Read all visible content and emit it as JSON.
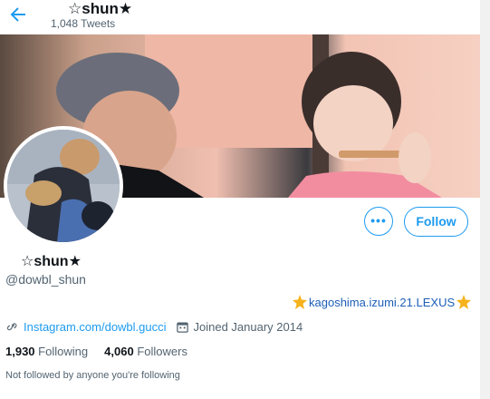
{
  "header": {
    "back_icon": "arrow-left-icon",
    "name": "☆shun★",
    "tweet_count": "1,048 Tweets"
  },
  "profile": {
    "display_name": "☆shun★",
    "handle": "@dowbl_shun",
    "bio": "kagoshima.izumi.21.LEXUS",
    "website": "Instagram.com/dowbl.gucci",
    "joined": "Joined January 2014",
    "following_count": "1,930",
    "following_label": "Following",
    "followers_count": "4,060",
    "followers_label": "Followers",
    "followed_by": "Not followed by anyone you're following"
  },
  "actions": {
    "more_label": "•••",
    "follow_label": "Follow"
  },
  "colors": {
    "accent": "#1d9bf0",
    "secondary_text": "#536471"
  }
}
